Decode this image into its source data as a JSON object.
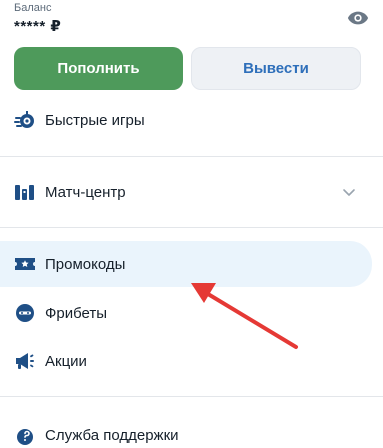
{
  "balance": {
    "label": "Баланс",
    "value": "***** ₽"
  },
  "actions": {
    "deposit_label": "Пополнить",
    "withdraw_label": "Вывести"
  },
  "menu": {
    "quick_games": "Быстрые игры",
    "match_center": "Матч-центр",
    "promo_codes": "Промокоды",
    "freebets": "Фрибеты",
    "promotions": "Акции",
    "support": "Служба поддержки"
  },
  "colors": {
    "accent_green": "#4e9a5b",
    "accent_blue": "#2e6fba",
    "icon_blue": "#1f4f86",
    "active_bg": "#eaf4fc",
    "annotation_red": "#e53935"
  }
}
